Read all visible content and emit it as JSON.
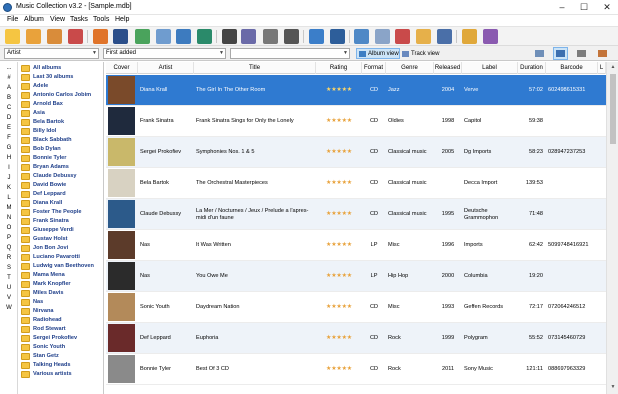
{
  "window": {
    "title": "Music Collection v3.2 - [Sample.mdb]"
  },
  "menu": [
    "File",
    "Album",
    "View",
    "Tasks",
    "Tools",
    "Help"
  ],
  "filters": {
    "field": "Artist",
    "sort": "First added",
    "search_value": "",
    "album_view_label": "Album view",
    "track_view_label": "Track view"
  },
  "alpha": [
    "...",
    "#",
    "A",
    "B",
    "C",
    "D",
    "E",
    "F",
    "G",
    "H",
    "I",
    "J",
    "K",
    "L",
    "M",
    "N",
    "O",
    "P",
    "Q",
    "R",
    "S",
    "T",
    "U",
    "V",
    "W"
  ],
  "tree": [
    "All albums",
    "Last 30 albums",
    "Adele",
    "Antonio Carlos Jobim",
    "Arnold Bax",
    "Asia",
    "Bela Bartok",
    "Billy Idol",
    "Black Sabbath",
    "Bob Dylan",
    "Bonnie Tyler",
    "Bryan Adams",
    "Claude Debussy",
    "David Bowie",
    "Def Leppard",
    "Diana Krall",
    "Foster The People",
    "Frank Sinatra",
    "Giuseppe Verdi",
    "Gustav Holst",
    "Jon Bon Jovi",
    "Luciano Pavarotti",
    "Ludwig van Beethoven",
    "Mama Mena",
    "Mark Knopfler",
    "Miles Davis",
    "Nas",
    "Nirvana",
    "Radiohead",
    "Rod Stewart",
    "Sergei Prokofiev",
    "Sonic Youth",
    "Stan Getz",
    "Talking Heads",
    "Various artists"
  ],
  "columns": [
    "Cover",
    "Artist",
    "Title",
    "Rating",
    "Format",
    "Genre",
    "Released",
    "Label",
    "Duration",
    "Barcode",
    "L"
  ],
  "rows": [
    {
      "artist": "Diana Krall",
      "title": "The Girl In The Other Room",
      "rating": "★★★★★",
      "format": "CD",
      "genre": "Jazz",
      "released": "2004",
      "label": "Verve",
      "duration": "57:02",
      "barcode": "602498615331",
      "cover_color": "#7a4a2a",
      "selected": true
    },
    {
      "artist": "Frank Sinatra",
      "title": "Frank Sinatra Sings for Only the Lonely",
      "rating": "★★★★★",
      "format": "CD",
      "genre": "Oldies",
      "released": "1998",
      "label": "Capitol",
      "duration": "59:38",
      "barcode": "",
      "cover_color": "#1f2a3d"
    },
    {
      "artist": "Sergei Prokofiev",
      "title": "Symphonies Nos. 1 & 5",
      "rating": "★★★★★",
      "format": "CD",
      "genre": "Classical music",
      "released": "2005",
      "label": "Dg Imports",
      "duration": "58:23",
      "barcode": "028947237253",
      "cover_color": "#c9b86a"
    },
    {
      "artist": "Bela Bartok",
      "title": "The Orchestral Masterpieces",
      "rating": "★★★★★",
      "format": "CD",
      "genre": "Classical music",
      "released": "",
      "label": "Decca Import",
      "duration": "139:53",
      "barcode": "",
      "cover_color": "#d8d2c2"
    },
    {
      "artist": "Claude Debussy",
      "title": "La Mer / Nocturnes / Jeux / Prelude a l'apres-midi d'un faune",
      "rating": "★★★★★",
      "format": "CD",
      "genre": "Classical music",
      "released": "1995",
      "label": "Deutsche Grammophon",
      "duration": "71:48",
      "barcode": "",
      "cover_color": "#2c5a8a"
    },
    {
      "artist": "Nas",
      "title": "It Was Written",
      "rating": "★★★★★",
      "format": "LP",
      "genre": "Misc",
      "released": "1996",
      "label": "Imports",
      "duration": "62:42",
      "barcode": "5099748416921",
      "cover_color": "#5c3b2a"
    },
    {
      "artist": "Nas",
      "title": "You Owe Me",
      "rating": "★★★★★",
      "format": "LP",
      "genre": "Hip Hop",
      "released": "2000",
      "label": "Columbia",
      "duration": "19:20",
      "barcode": "",
      "cover_color": "#2b2b2b"
    },
    {
      "artist": "Sonic Youth",
      "title": "Daydream Nation",
      "rating": "★★★★★",
      "format": "CD",
      "genre": "Misc",
      "released": "1993",
      "label": "Geffen Records",
      "duration": "72:17",
      "barcode": "072064246512",
      "cover_color": "#b38a5a"
    },
    {
      "artist": "Def Leppard",
      "title": "Euphoria",
      "rating": "★★★★★",
      "format": "CD",
      "genre": "Rock",
      "released": "1999",
      "label": "Polygram",
      "duration": "55:52",
      "barcode": "073145460729",
      "cover_color": "#6a2a2a"
    },
    {
      "artist": "Bonnie Tyler",
      "title": "Best Of 3 CD",
      "rating": "★★★★★",
      "format": "CD",
      "genre": "Rock",
      "released": "2011",
      "label": "Sony Music",
      "duration": "121:11",
      "barcode": "088697963329",
      "cover_color": "#8a8a8a"
    }
  ],
  "colors": {
    "selection": "#2f7ad1",
    "alt_row": "#eef3f9",
    "tree_text": "#1f3f8a",
    "star": "#e8a23b"
  }
}
